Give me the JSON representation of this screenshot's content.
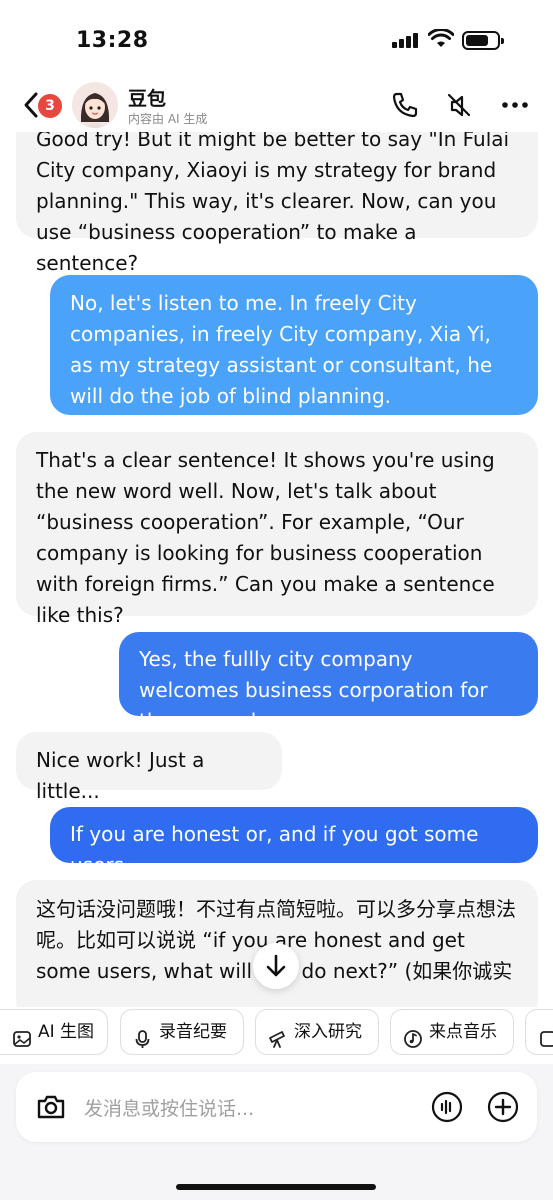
{
  "status_bar": {
    "time": "13:28"
  },
  "header": {
    "back_badge": "3",
    "title": "豆包",
    "subtitle": "内容由 AI 生成"
  },
  "messages": [
    {
      "role": "bot",
      "text": "Good try! But it might be better to say \"In Fulai City company, Xiaoyi is my strategy for brand planning.\" This way, it's clearer. Now, can you use “business cooperation” to make a sentence?"
    },
    {
      "role": "user",
      "text": "No, let's listen to me. In freely City companies, in freely City company, Xia Yi, as my strategy assistant or consultant, he will do the job of blind planning."
    },
    {
      "role": "bot",
      "text": "That's a clear sentence! It shows you're using the new word well. Now, let's talk about “business cooperation”. For example, “Our company is looking for business cooperation with foreign firms.” Can you make a sentence like this?"
    },
    {
      "role": "user",
      "text": "Yes, the fullly city company welcomes business corporation for those peoples."
    },
    {
      "role": "bot",
      "text": "Nice work! Just a little..."
    },
    {
      "role": "user",
      "text": "If you are honest or, and if you got some users."
    },
    {
      "role": "bot",
      "text": "这句话没问题哦！不过有点简短啦。可以多分享点想法呢。比如可以说说 “if you are honest and get some users, what will you do next?” (如果你诚实"
    }
  ],
  "quick_actions": [
    {
      "label": "AI 生图",
      "icon": "image-icon"
    },
    {
      "label": "录音纪要",
      "icon": "microphone-icon"
    },
    {
      "label": "深入研究",
      "icon": "telescope-icon"
    },
    {
      "label": "来点音乐",
      "icon": "music-icon"
    }
  ],
  "input": {
    "placeholder": "发消息或按住说话..."
  },
  "colors": {
    "user_bubble_light": "#4aa3f8",
    "user_bubble_dark": "#2f6cf0",
    "bot_bubble": "#f3f3f4",
    "badge": "#e8473e"
  }
}
